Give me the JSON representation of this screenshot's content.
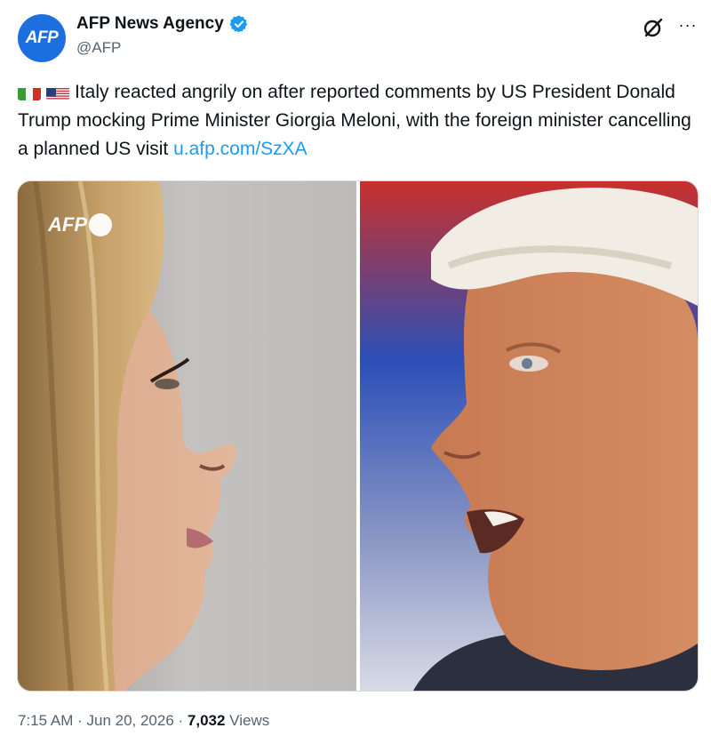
{
  "author": {
    "avatar_text": "AFP",
    "display_name": "AFP News Agency",
    "handle": "@AFP",
    "verified": true
  },
  "header_actions": {
    "grok_icon": "grok-icon",
    "more_label": "···"
  },
  "tweet": {
    "flags": [
      "italy-flag",
      "us-flag"
    ],
    "text": "Italy reacted angrily on after reported comments by US President Donald Trump mocking Prime Minister Giorgia Meloni, with the foreign minister cancelling a planned US visit ",
    "link": "u.afp.com/SzXA"
  },
  "media": {
    "watermark": "AFP",
    "images": [
      "meloni-profile-photo",
      "trump-profile-photo"
    ]
  },
  "meta": {
    "time": "7:15 AM",
    "sep1": " · ",
    "date": "Jun 20, 2026",
    "sep2": " · ",
    "views_count": "7,032",
    "views_label": " Views"
  },
  "colors": {
    "link": "#1d9bf0",
    "verified": "#1d9bf0",
    "avatar_bg": "#1d6fe0",
    "secondary_text": "#536471"
  }
}
